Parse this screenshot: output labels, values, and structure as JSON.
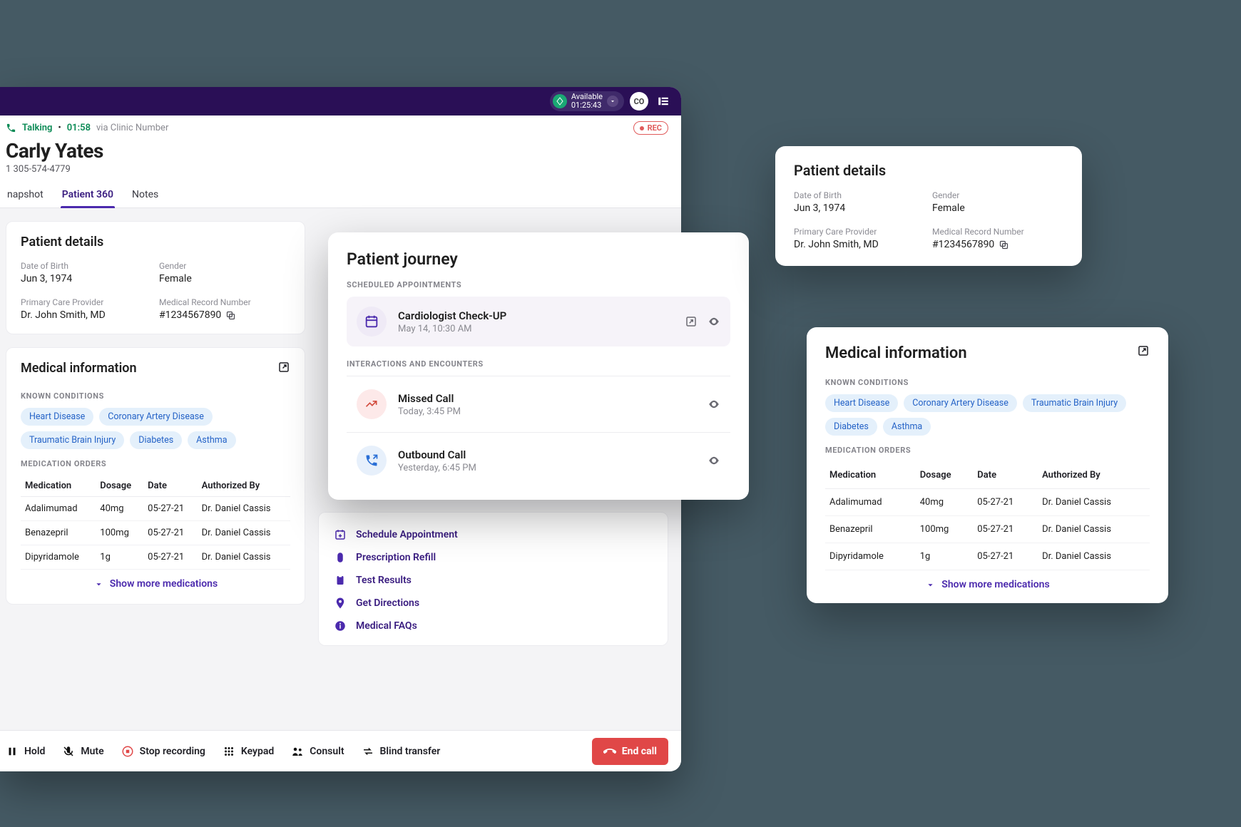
{
  "header": {
    "availability_label": "Available",
    "availability_timer": "01:25:43",
    "avatar_initials": "CO"
  },
  "call_status": {
    "state": "Talking",
    "duration": "01:58",
    "via": "via Clinic Number",
    "rec_label": "REC"
  },
  "patient": {
    "name": "Carly Yates",
    "phone": "1 305-574-4779"
  },
  "tabs": {
    "snapshot": "napshot",
    "patient360": "Patient 360",
    "notes": "Notes"
  },
  "patient_details": {
    "title": "Patient details",
    "dob_label": "Date of Birth",
    "dob_value": "Jun 3, 1974",
    "gender_label": "Gender",
    "gender_value": "Female",
    "pcp_label": "Primary Care Provider",
    "pcp_value": "Dr. John Smith, MD",
    "mrn_label": "Medical Record Number",
    "mrn_value": "#1234567890"
  },
  "medical_info": {
    "title": "Medical information",
    "known_conditions_label": "KNOWN CONDITIONS",
    "conditions": [
      "Heart Disease",
      "Coronary Artery Disease",
      "Traumatic Brain Injury",
      "Diabetes",
      "Asthma"
    ],
    "medication_orders_label": "MEDICATION ORDERS",
    "columns": {
      "med": "Medication",
      "dosage": "Dosage",
      "date": "Date",
      "auth": "Authorized By"
    },
    "rows": [
      {
        "med": "Adalimumad",
        "dosage": "40mg",
        "date": "05-27-21",
        "auth": "Dr. Daniel Cassis"
      },
      {
        "med": "Benazepril",
        "dosage": "100mg",
        "date": "05-27-21",
        "auth": "Dr. Daniel Cassis"
      },
      {
        "med": "Dipyridamole",
        "dosage": "1g",
        "date": "05-27-21",
        "auth": "Dr. Daniel Cassis"
      }
    ],
    "show_more": "Show more medications"
  },
  "journey": {
    "title": "Patient journey",
    "scheduled_label": "SCHEDULED APPOINTMENTS",
    "appointment": {
      "title": "Cardiologist Check-UP",
      "sub": "May 14, 10:30 AM"
    },
    "interactions_label": "INTERACTIONS AND ENCOUNTERS",
    "missed": {
      "title": "Missed Call",
      "sub": "Today, 3:45 PM"
    },
    "outbound": {
      "title": "Outbound Call",
      "sub": "Yesterday, 6:45 PM"
    }
  },
  "quick_actions": {
    "schedule": "Schedule Appointment",
    "refill": "Prescription Refill",
    "tests": "Test Results",
    "directions": "Get Directions",
    "faqs": "Medical FAQs"
  },
  "call_bar": {
    "hold": "Hold",
    "mute": "Mute",
    "stop_rec": "Stop recording",
    "keypad": "Keypad",
    "consult": "Consult",
    "blind": "Blind transfer",
    "end": "End call"
  }
}
